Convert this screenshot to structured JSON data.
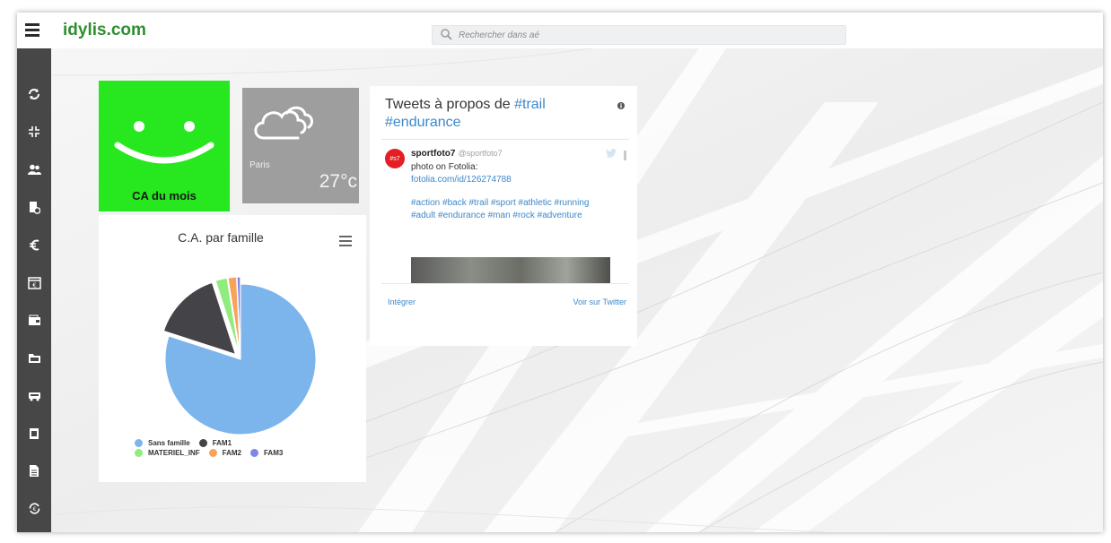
{
  "app": {
    "logo": "idylis.com",
    "search_placeholder": "Rechercher dans aé"
  },
  "sidebar": {
    "icons": [
      "sync-icon",
      "compress-icon",
      "users-icon",
      "document-clock-icon",
      "euro-icon",
      "calendar-euro-icon",
      "wallet-icon",
      "folder-icon",
      "vehicle-icon",
      "clipboard-icon",
      "file-icon",
      "refresh-euro-icon"
    ]
  },
  "tiles": {
    "ca_month_label": "CA du mois",
    "weather_city": "Paris",
    "weather_temp": "27°c"
  },
  "pie_widget": {
    "title": "C.A. par famille",
    "legend_row1": [
      {
        "label": "Sans famille",
        "color": "#7cb5ec"
      },
      {
        "label": "FAM1",
        "color": "#434348"
      }
    ],
    "legend_row2": [
      {
        "label": "MATERIEL_INF",
        "color": "#90ed7d"
      },
      {
        "label": "FAM2",
        "color": "#f7a35c"
      },
      {
        "label": "FAM3",
        "color": "#8085e9"
      }
    ],
    "slices": [
      {
        "label": "Sans famille",
        "share": 0.8,
        "color": "#7cb5ec"
      },
      {
        "label": "FAM1",
        "share": 0.15,
        "color": "#434348"
      },
      {
        "label": "MATERIEL_INF",
        "share": 0.025,
        "color": "#90ed7d"
      },
      {
        "label": "FAM2",
        "share": 0.018,
        "color": "#f7a35c"
      },
      {
        "label": "FAM3",
        "share": 0.007,
        "color": "#8085e9"
      }
    ]
  },
  "twitter": {
    "title_prefix": "Tweets à propos de ",
    "title_tag1": "#trail",
    "title_tag2": "#endurance",
    "avatar": "#s7",
    "user": "sportfoto7",
    "handle": "@sportfoto7",
    "text": "photo on Fotolia:",
    "link": "fotolia.com/id/126274788",
    "hashtags": "#action #back #trail #sport #athletic #running #adult #endurance #man #rock #adventure",
    "embed": "Intégrer",
    "view": "Voir sur Twitter"
  },
  "colors": {
    "logo": "#2e8f2e",
    "tile_green": "#27e81f",
    "tile_weather": "#9e9e9e",
    "sidebar": "#474747",
    "link": "#3d88c9"
  }
}
